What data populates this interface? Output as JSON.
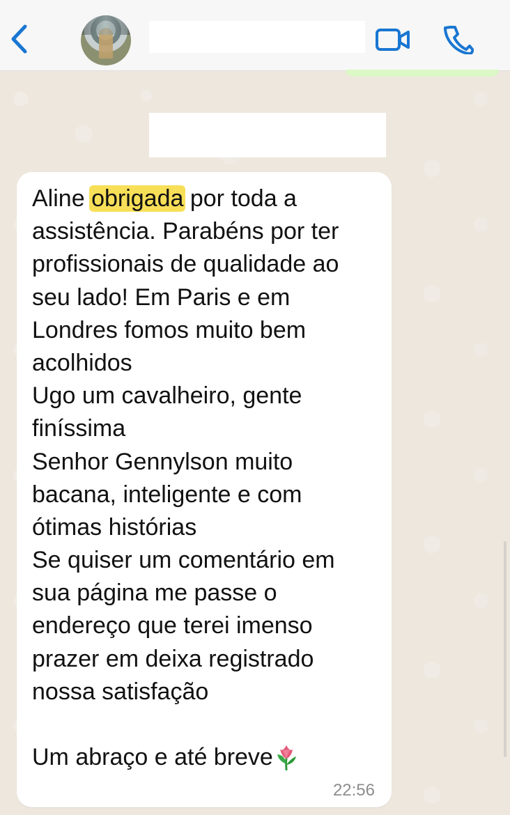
{
  "header": {
    "back_icon": "chevron-left-icon",
    "video_icon": "video-call-icon",
    "phone_icon": "phone-call-icon",
    "accent_color": "#1976d2"
  },
  "message": {
    "lines": [
      {
        "before": "Aline ",
        "highlight": "obrigada",
        "after": " por toda a"
      },
      {
        "text": "assistência. Parabéns por ter"
      },
      {
        "text": "profissionais de qualidade ao"
      },
      {
        "text": "seu lado! Em Paris e em"
      },
      {
        "text": "Londres fomos muito bem"
      },
      {
        "text": "acolhidos"
      },
      {
        "text": "Ugo um cavalheiro, gente"
      },
      {
        "text": "finíssima"
      },
      {
        "text": "Senhor Gennylson muito"
      },
      {
        "text": "bacana, inteligente e com"
      },
      {
        "text": "ótimas histórias"
      },
      {
        "text": "Se quiser um comentário em"
      },
      {
        "text": "sua página me passe o"
      },
      {
        "text": "endereço que terei imenso"
      },
      {
        "text": "prazer em deixa registrado"
      },
      {
        "text": "nossa satisfação"
      },
      {
        "text": ""
      },
      {
        "text": "Um abraço e até breve",
        "emoji": "tulip-icon"
      }
    ],
    "time": "22:56",
    "highlight_color": "#f8df58"
  }
}
